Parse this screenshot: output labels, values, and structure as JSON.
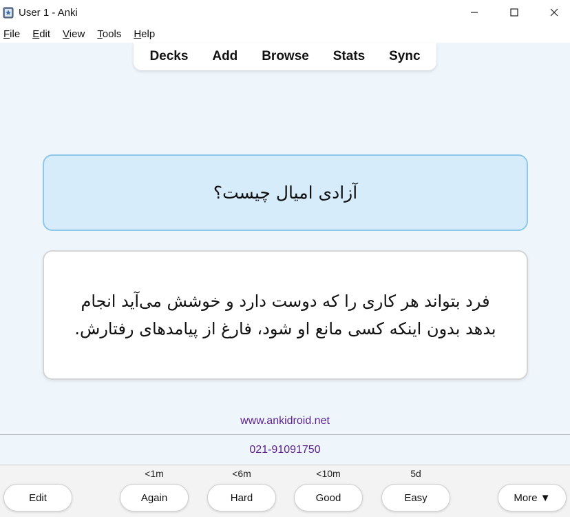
{
  "window": {
    "title": "User 1 - Anki",
    "app_icon": "anki-icon"
  },
  "menu": {
    "items": [
      {
        "underline": "F",
        "rest": "ile"
      },
      {
        "underline": "E",
        "rest": "dit"
      },
      {
        "underline": "V",
        "rest": "iew"
      },
      {
        "underline": "T",
        "rest": "ools"
      },
      {
        "underline": "H",
        "rest": "elp"
      }
    ]
  },
  "toolbar": {
    "decks": "Decks",
    "add": "Add",
    "browse": "Browse",
    "stats": "Stats",
    "sync": "Sync"
  },
  "card": {
    "question": "آزادی امیال چیست؟",
    "answer": "فرد بتواند هر کاری را که دوست دارد و خوشش می‌آید انجام بدهد بدون اینکه کسی مانع او شود، فارغ از پیامدهای رفتارش."
  },
  "info": {
    "website": "www.ankidroid.net",
    "phone": "021-91091750"
  },
  "bottom": {
    "edit": "Edit",
    "again": "Again",
    "hard": "Hard",
    "good": "Good",
    "easy": "Easy",
    "more": "More ▼",
    "intervals": {
      "again": "<1m",
      "hard": "<6m",
      "good": "<10m",
      "easy": "5d"
    }
  },
  "colors": {
    "question_bg": "#d7ecfb",
    "question_border": "#8ec7ea",
    "main_bg": "#eef6fc",
    "info_text": "#5a1e8c"
  }
}
